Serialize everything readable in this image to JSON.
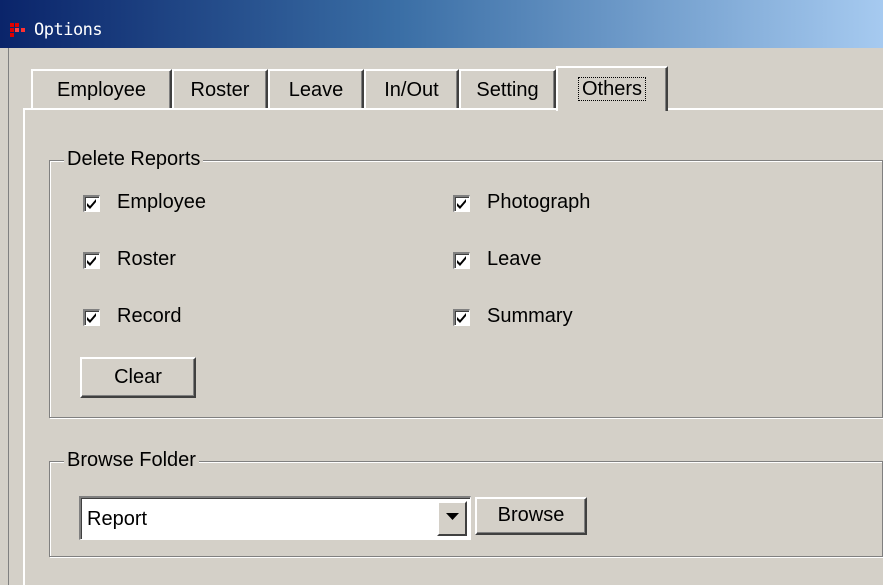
{
  "window": {
    "title": "Options"
  },
  "tabs": [
    {
      "label": "Employee",
      "active": false
    },
    {
      "label": "Roster",
      "active": false
    },
    {
      "label": "Leave",
      "active": false
    },
    {
      "label": "In/Out",
      "active": false
    },
    {
      "label": "Setting",
      "active": false
    },
    {
      "label": "Others",
      "active": true
    }
  ],
  "delete_reports": {
    "legend": "Delete Reports",
    "checkboxes": [
      {
        "label": "Employee",
        "checked": true
      },
      {
        "label": "Photograph",
        "checked": true
      },
      {
        "label": "Roster",
        "checked": true
      },
      {
        "label": "Leave",
        "checked": true
      },
      {
        "label": "Record",
        "checked": true
      },
      {
        "label": "Summary",
        "checked": true
      }
    ],
    "clear_label": "Clear"
  },
  "browse_folder": {
    "legend": "Browse Folder",
    "folder_value": "Report",
    "browse_label": "Browse"
  },
  "icons": {
    "app": "app-grid-icon",
    "checkmark": "checkmark-icon",
    "dropdown": "chevron-down-icon"
  },
  "colors": {
    "face": "#d4d0c8",
    "titlebar_start": "#0a246a",
    "titlebar_end": "#a6caf0",
    "app_icon": "#e00000"
  }
}
